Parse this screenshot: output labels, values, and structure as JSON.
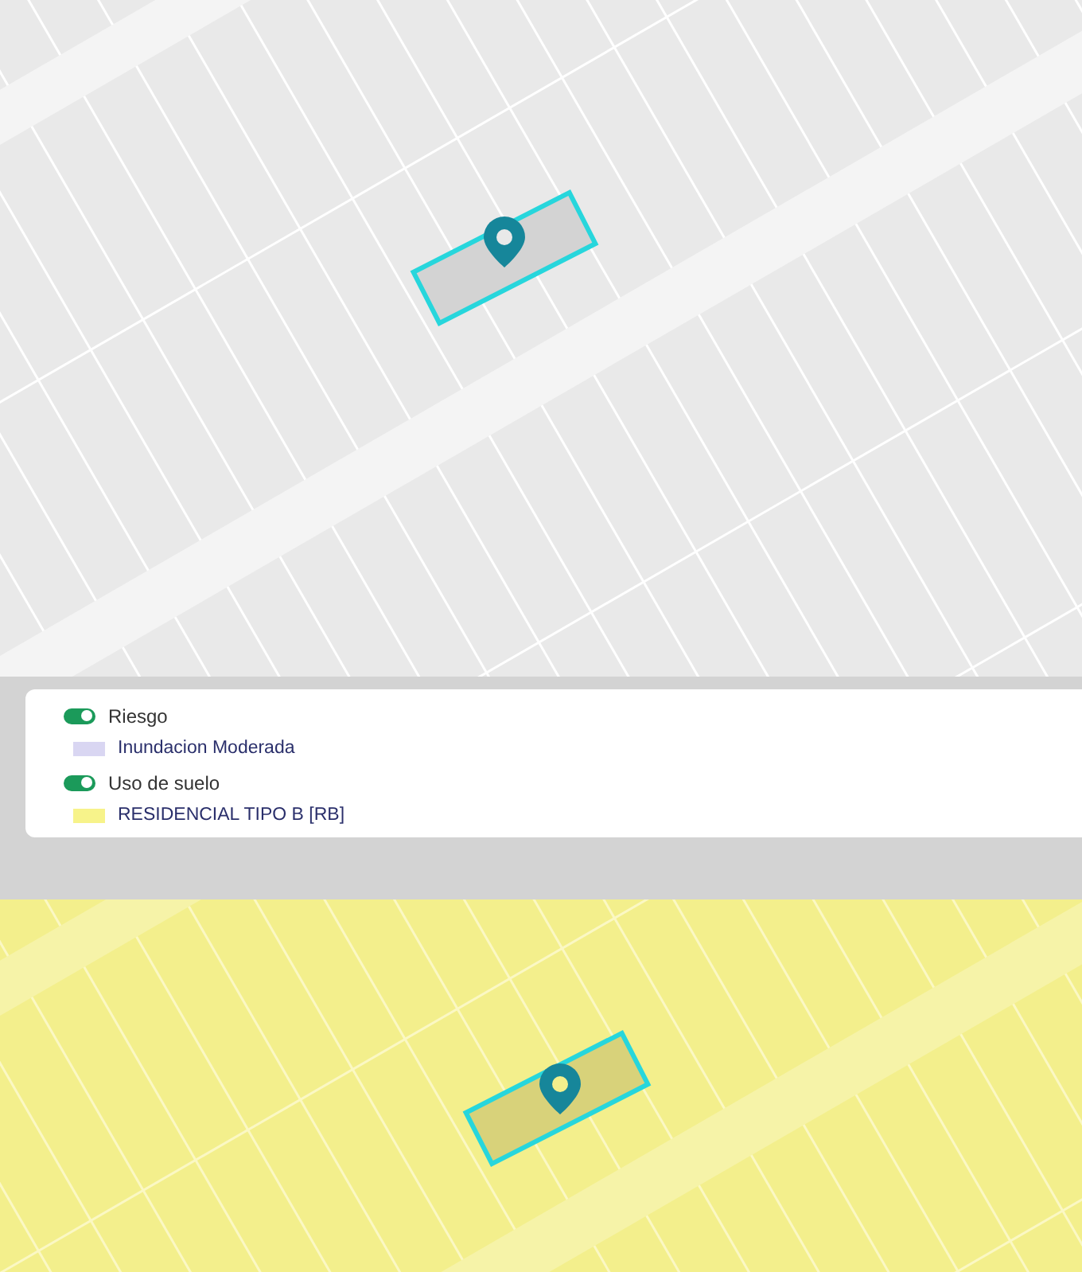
{
  "legend": {
    "items": [
      {
        "kind": "layer",
        "label": "Riesgo",
        "on": true
      },
      {
        "kind": "swatch",
        "label": "Inundacion Moderada",
        "color": "#d9d6f2"
      },
      {
        "kind": "layer",
        "label": "Uso de suelo",
        "on": true
      },
      {
        "kind": "swatch",
        "label": "RESIDENCIAL TIPO B [RB]",
        "color": "#f7f38a"
      }
    ]
  }
}
